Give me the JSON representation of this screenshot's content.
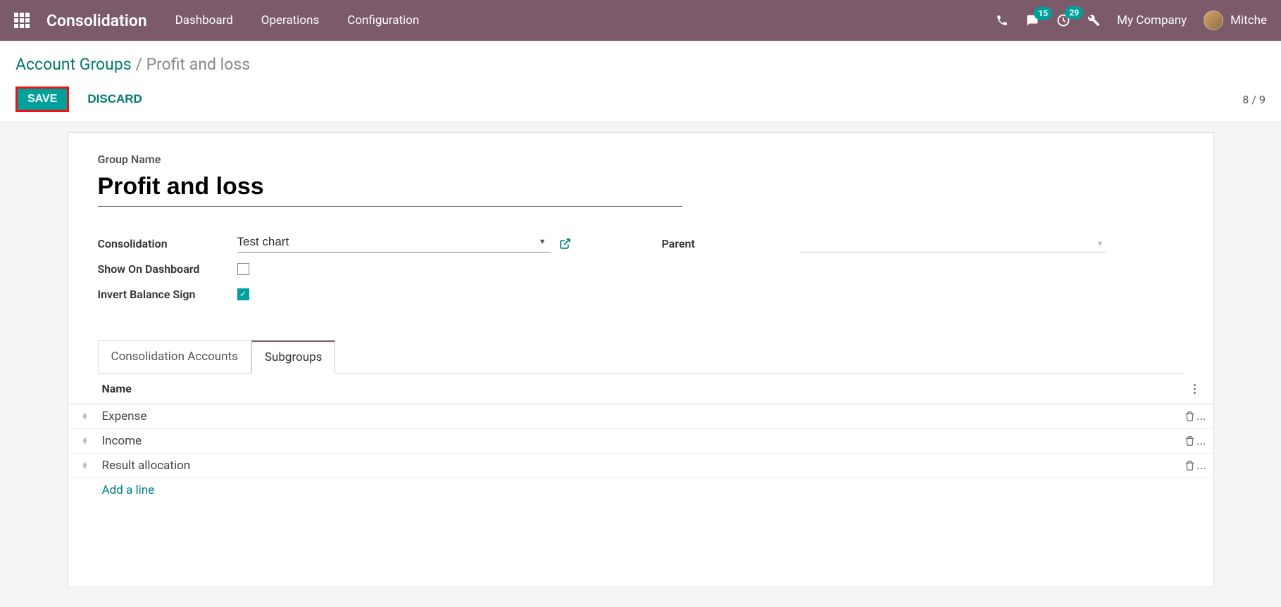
{
  "header": {
    "app_name": "Consolidation",
    "nav": [
      "Dashboard",
      "Operations",
      "Configuration"
    ],
    "badge_messages": "15",
    "badge_activities": "29",
    "company": "My Company",
    "user": "Mitche"
  },
  "breadcrumb": {
    "parent": "Account Groups",
    "sep": "/",
    "current": "Profit and loss"
  },
  "actions": {
    "save": "SAVE",
    "discard": "DISCARD",
    "pager_current": "8",
    "pager_sep": "/",
    "pager_total": "9"
  },
  "form": {
    "group_name_label": "Group Name",
    "group_name_value": "Profit and loss",
    "consolidation_label": "Consolidation",
    "consolidation_value": "Test chart",
    "show_dashboard_label": "Show On Dashboard",
    "show_dashboard_checked": false,
    "invert_sign_label": "Invert Balance Sign",
    "invert_sign_checked": true,
    "parent_label": "Parent",
    "parent_value": ""
  },
  "tabs": {
    "tab1": "Consolidation Accounts",
    "tab2": "Subgroups"
  },
  "table": {
    "col_name": "Name",
    "rows": [
      {
        "name": "Expense"
      },
      {
        "name": "Income"
      },
      {
        "name": "Result allocation"
      }
    ],
    "add_line": "Add a line"
  }
}
